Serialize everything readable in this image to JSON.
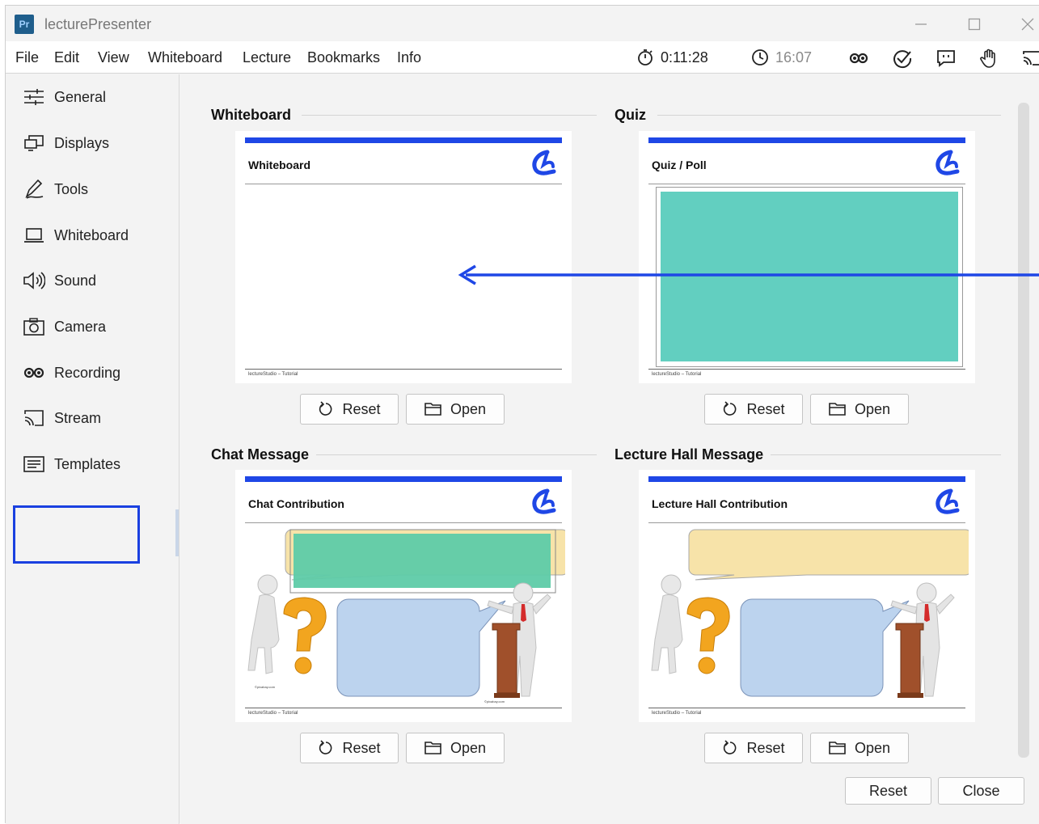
{
  "window": {
    "title": "lecturePresenter",
    "app_icon_text": "Pr"
  },
  "menu": {
    "items": [
      "File",
      "Edit",
      "View",
      "Whiteboard",
      "Lecture",
      "Bookmarks",
      "Info"
    ]
  },
  "toolbar": {
    "timer": "0:11:28",
    "clock": "16:07",
    "icons": [
      "stopwatch-icon",
      "clock-icon",
      "recording-icon",
      "check-circle-icon",
      "chat-icon",
      "hand-icon",
      "stream-icon"
    ]
  },
  "sidebar": {
    "items": [
      {
        "label": "General",
        "icon": "sliders-icon"
      },
      {
        "label": "Displays",
        "icon": "displays-icon"
      },
      {
        "label": "Tools",
        "icon": "pen-icon"
      },
      {
        "label": "Whiteboard",
        "icon": "laptop-icon"
      },
      {
        "label": "Sound",
        "icon": "speaker-icon"
      },
      {
        "label": "Camera",
        "icon": "camera-icon"
      },
      {
        "label": "Recording",
        "icon": "recording-icon"
      },
      {
        "label": "Stream",
        "icon": "cast-icon"
      },
      {
        "label": "Templates",
        "icon": "template-icon"
      }
    ],
    "selected": "Templates"
  },
  "sections": {
    "whiteboard": {
      "title": "Whiteboard",
      "template_title": "Whiteboard",
      "footer": "lectureStudio – Tutorial"
    },
    "quiz": {
      "title": "Quiz",
      "template_title": "Quiz / Poll",
      "footer": "lectureStudio – Tutorial"
    },
    "chat": {
      "title": "Chat Message",
      "template_title": "Chat Contribution",
      "footer": "lectureStudio – Tutorial",
      "credit_left": "©pixabay.com",
      "credit_right": "©pixabay.com"
    },
    "hall": {
      "title": "Lecture Hall Message",
      "template_title": "Lecture Hall Contribution",
      "footer": "lectureStudio – Tutorial"
    }
  },
  "buttons": {
    "reset": "Reset",
    "open": "Open",
    "footer_reset": "Reset",
    "footer_close": "Close"
  },
  "colors": {
    "accent_blue": "#1f47e6",
    "quiz_fill": "#62cfc0",
    "chat_fill": "#5ecba8",
    "speech_yellow": "#f7e3a9",
    "speech_blue": "#bcd3ee"
  }
}
